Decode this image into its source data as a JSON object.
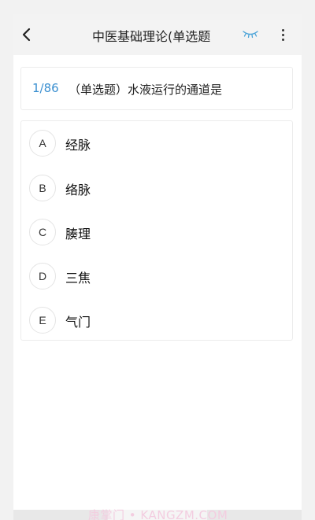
{
  "header": {
    "title": "中医基础理论(单选题",
    "back_icon": "chevron-left-icon",
    "eye_icon": "eye-closed-icon",
    "more_icon": "more-vertical-icon",
    "eye_color": "#4aa3d8"
  },
  "question": {
    "number": "1/86",
    "text": "（单选题）水液运行的通道是"
  },
  "options": [
    {
      "letter": "A",
      "text": "经脉"
    },
    {
      "letter": "B",
      "text": "络脉"
    },
    {
      "letter": "C",
      "text": "腠理"
    },
    {
      "letter": "D",
      "text": "三焦"
    },
    {
      "letter": "E",
      "text": "气门"
    }
  ],
  "watermark": "康掌门 • KANGZM.COM"
}
